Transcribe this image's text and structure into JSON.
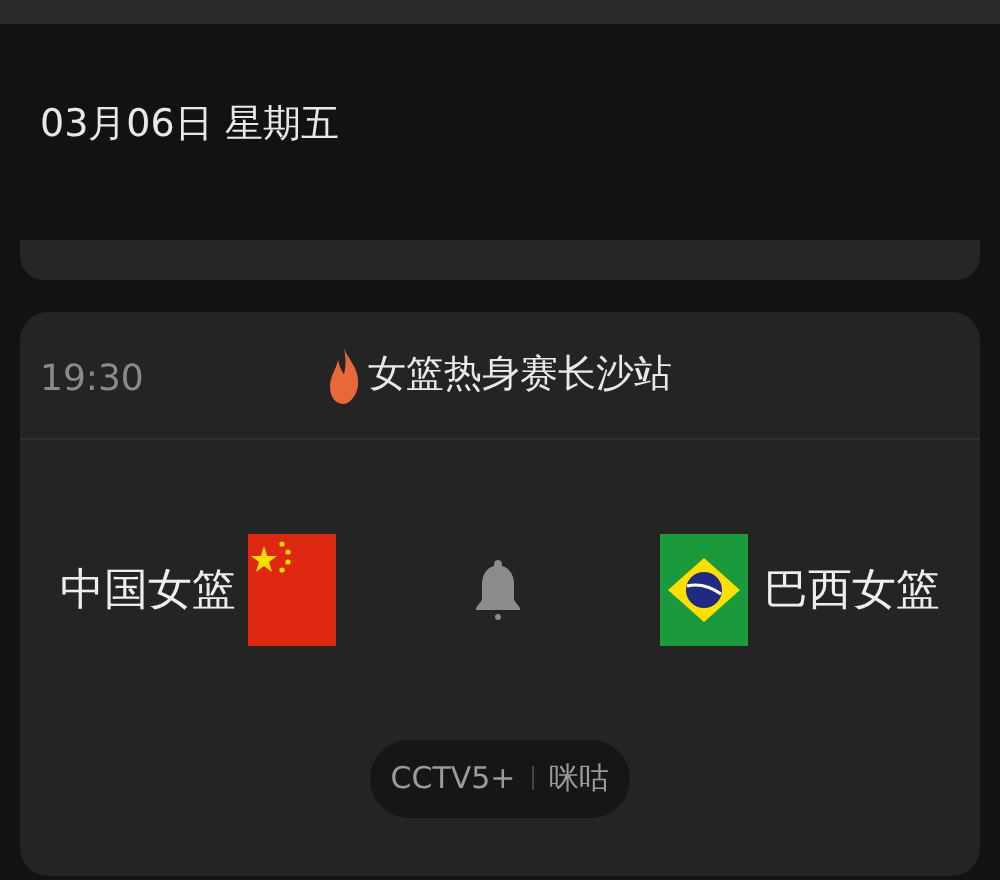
{
  "date_header": "03月06日 星期五",
  "match": {
    "time": "19:30",
    "title": "女篮热身赛长沙站",
    "teams": [
      {
        "name": "中国女篮",
        "kind": "china"
      },
      {
        "name": "巴西女篮",
        "kind": "brazil"
      }
    ],
    "channels": [
      "CCTV5+",
      "咪咕"
    ]
  }
}
